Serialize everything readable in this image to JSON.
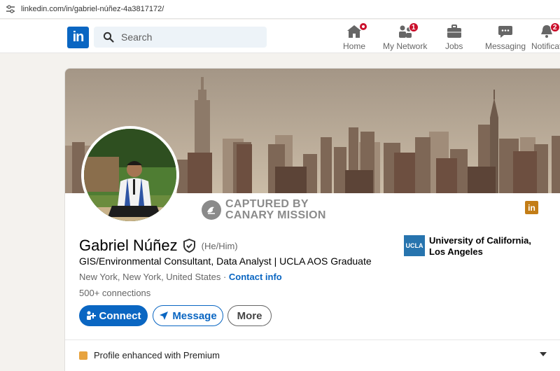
{
  "browser": {
    "url": "linkedin.com/in/gabriel-núñez-4a3817172/"
  },
  "nav": {
    "logo": "in",
    "search_placeholder": "Search",
    "items": [
      {
        "label": "Home",
        "badge": ""
      },
      {
        "label": "My Network",
        "badge": "1"
      },
      {
        "label": "Jobs",
        "badge": ""
      },
      {
        "label": "Messaging",
        "badge": ""
      },
      {
        "label": "Notificat",
        "badge": "2"
      }
    ]
  },
  "profile": {
    "watermark_line1": "CAPTURED BY",
    "watermark_line2": "CANARY MISSION",
    "name": "Gabriel Núñez",
    "pronouns": "(He/Him)",
    "headline": "GIS/Environmental Consultant, Data Analyst | UCLA AOS Graduate",
    "location": "New York, New York, United States ·",
    "contact_label": "Contact info",
    "connections": "500+ connections",
    "buttons": {
      "connect": "Connect",
      "message": "Message",
      "more": "More"
    },
    "education": {
      "logo": "UCLA",
      "name": "University of California, Los Angeles"
    },
    "premium_text": "Profile enhanced with Premium"
  },
  "colors": {
    "brand": "#0a66c2",
    "badge": "#cb112d",
    "premium": "#e7a33e"
  }
}
